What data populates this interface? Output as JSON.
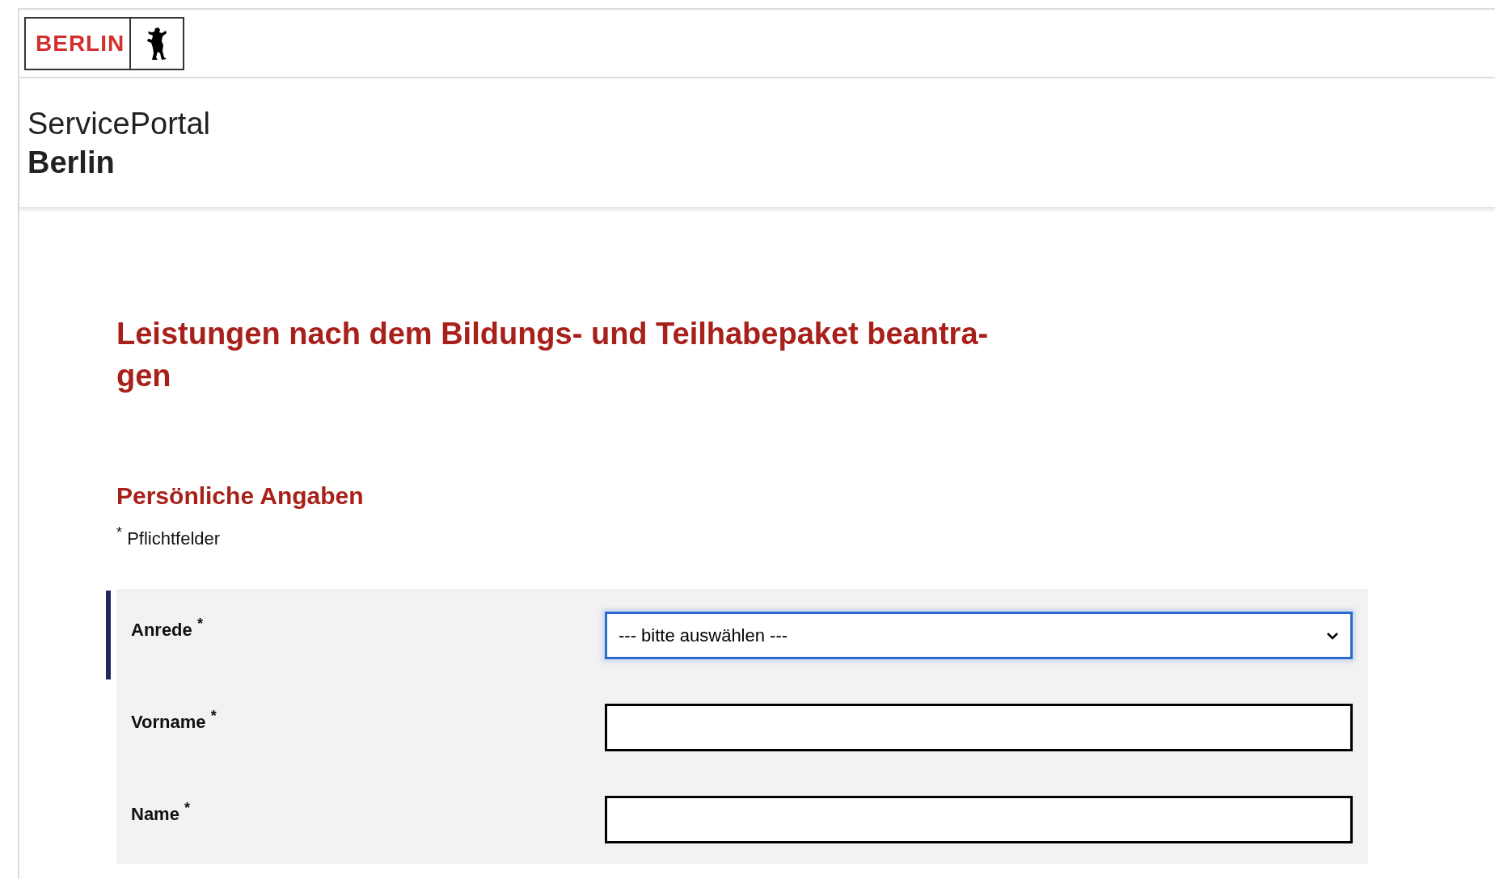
{
  "logo": {
    "text": "BERLIN"
  },
  "portal": {
    "line1": "ServicePortal",
    "line2": "Berlin"
  },
  "title": "Leistungen nach dem Bildungs- und Teilhabepaket beantra-gen",
  "section": {
    "heading": "Persönliche Angaben",
    "legend_mark": "*",
    "legend_text": "Pflichtfelder"
  },
  "fields": [
    {
      "label": "Anrede",
      "mark": "*",
      "kind": "select",
      "value": "--- bitte auswählen ---",
      "focused": true
    },
    {
      "label": "Vorname",
      "mark": "*",
      "kind": "text",
      "focused": false
    },
    {
      "label": "Name",
      "mark": "*",
      "kind": "text",
      "focused": false
    }
  ]
}
